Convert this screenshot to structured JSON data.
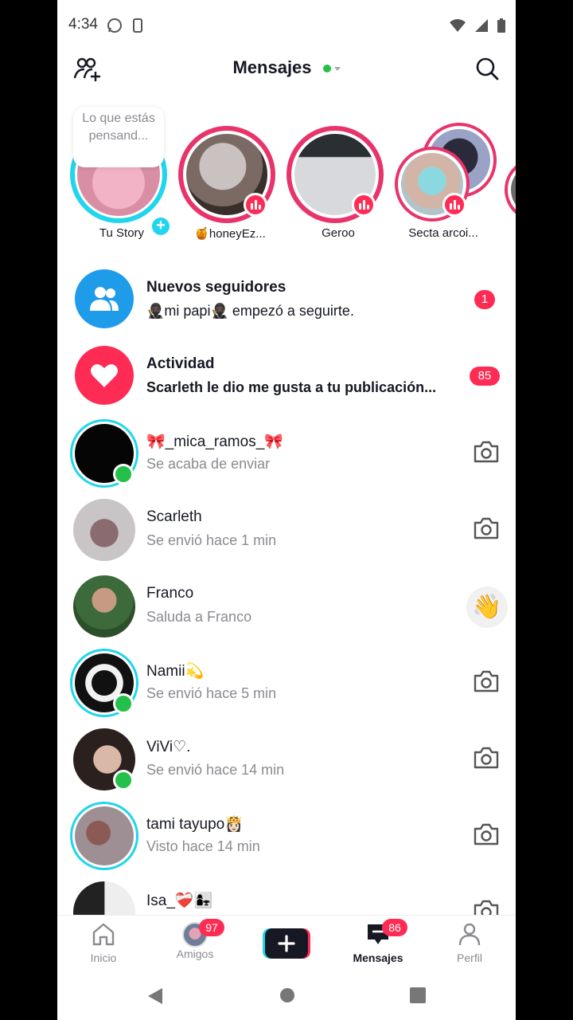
{
  "status": {
    "time": "4:34"
  },
  "header": {
    "title": "Mensajes"
  },
  "stories": [
    {
      "name": "Tu Story",
      "bubble": "Lo que estás pensand..."
    },
    {
      "name": "🍯honeyEz..."
    },
    {
      "name": "Geroo"
    },
    {
      "name": "Secta arcoi..."
    }
  ],
  "conversations": [
    {
      "name": "Nuevos seguidores",
      "sub": "🥷🏿mi papi🥷🏿 empezó a seguirte.",
      "badge": "1"
    },
    {
      "name": "Actividad",
      "sub": "Scarleth le dio me gusta a tu publicación...",
      "badge": "85"
    },
    {
      "name": "🎀_mica_ramos_🎀",
      "sub": "Se acaba de enviar"
    },
    {
      "name": "Scarleth",
      "sub": "Se envió hace 1 min"
    },
    {
      "name": "Franco",
      "sub": "Saluda a Franco",
      "action": "👋"
    },
    {
      "name": "Namii💫",
      "sub": "Se envió hace 5 min"
    },
    {
      "name": "ViVi♡.",
      "sub": "Se envió hace 14 min"
    },
    {
      "name": "tami tayupo👸🏻",
      "sub": "Visto hace 14 min"
    },
    {
      "name": "Isa_❤️‍🩹👩‍👧",
      "sub": ""
    }
  ],
  "nav": {
    "inicio": "Inicio",
    "amigos": "Amigos",
    "amigos_badge": "97",
    "mensajes": "Mensajes",
    "mensajes_badge": "86",
    "perfil": "Perfil"
  },
  "colors": {
    "accent": "#fe2c55",
    "cyan": "#20d5ec",
    "online": "#25c04a"
  }
}
